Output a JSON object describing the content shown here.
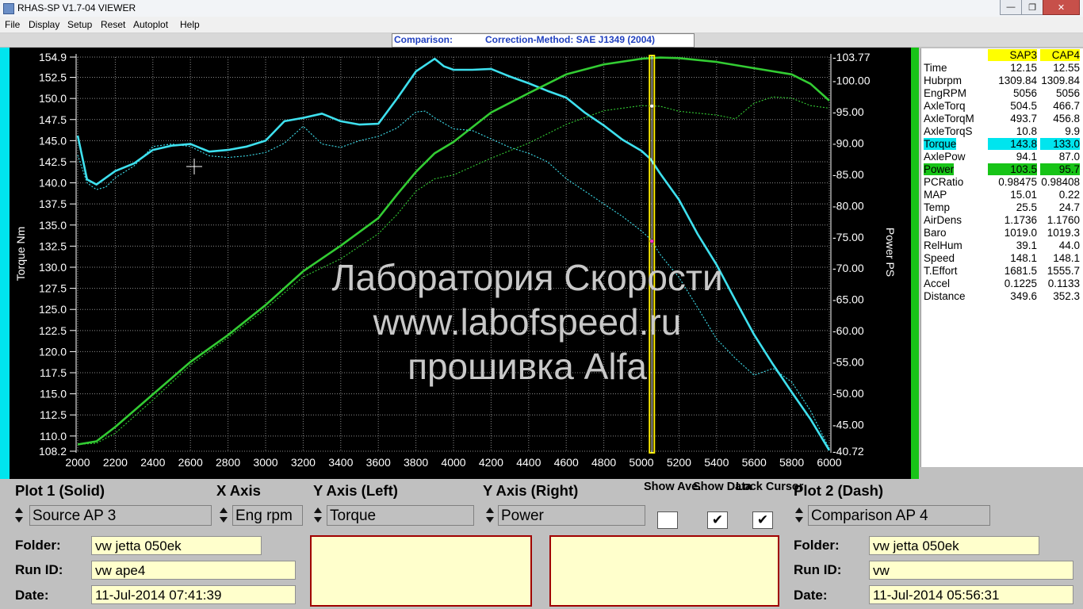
{
  "window": {
    "title": "RHAS-SP V1.7-04  VIEWER",
    "controls": {
      "minimize": "—",
      "maximize": "❐",
      "close": "✕"
    }
  },
  "menu": [
    "File",
    "Display",
    "Setup",
    "Reset",
    "Autoplot",
    "Help"
  ],
  "info": {
    "mode": "Comparison:",
    "correction": "Correction-Method: SAE J1349 (2004)"
  },
  "colors": {
    "torque": "#3ee0ee",
    "power": "#33cc33",
    "cursor": "#ffee00",
    "grid": "#8a8a8a"
  },
  "watermark": [
    "Лаборатория Скорости",
    "www.labofspeed.ru",
    "прошивка Alfa"
  ],
  "chart_data": {
    "type": "line",
    "xlabel": "",
    "ylabel_left": "Torque Nm",
    "ylabel_right": "Power PS",
    "xlim": [
      2000,
      6000
    ],
    "ylim_left": [
      108.2,
      154.9
    ],
    "ylim_right": [
      40.72,
      103.77
    ],
    "x_ticks": [
      "2000",
      "2200",
      "2400",
      "2600",
      "2800",
      "3000",
      "3200",
      "3400",
      "3600",
      "3800",
      "4000",
      "4200",
      "4400",
      "4600",
      "4800",
      "5000",
      "5200",
      "5400",
      "5600",
      "5800",
      "6000"
    ],
    "y_ticks_left": [
      "154.9",
      "152.5",
      "150.0",
      "147.5",
      "145.0",
      "142.5",
      "140.0",
      "137.5",
      "135.0",
      "132.5",
      "130.0",
      "127.5",
      "125.0",
      "122.5",
      "120.0",
      "117.5",
      "115.0",
      "112.5",
      "110.0",
      "108.2"
    ],
    "y_ticks_right": [
      "-103.77",
      "-100.00",
      "-95.00",
      "-90.00",
      "-85.00",
      "-80.00",
      "-75.00",
      "-70.00",
      "-65.00",
      "-60.00",
      "-55.00",
      "-50.00",
      "-45.00",
      "-40.72"
    ],
    "grid": true,
    "cursor_x": 5056,
    "series": [
      {
        "name": "Torque",
        "style": "solid",
        "axis": "left",
        "x": [
          2000,
          2050,
          2100,
          2150,
          2200,
          2300,
          2400,
          2500,
          2600,
          2700,
          2800,
          2900,
          3000,
          3100,
          3200,
          3300,
          3400,
          3500,
          3600,
          3700,
          3800,
          3900,
          3950,
          4000,
          4100,
          4200,
          4300,
          4400,
          4500,
          4600,
          4700,
          4800,
          4900,
          5000,
          5050,
          5100,
          5200,
          5300,
          5400,
          5500,
          5600,
          5700,
          5800,
          5900,
          6000
        ],
        "y": [
          145.6,
          140.4,
          139.8,
          140.6,
          141.4,
          142.3,
          143.9,
          144.4,
          144.6,
          143.7,
          143.9,
          144.3,
          145.0,
          147.3,
          147.7,
          148.2,
          147.3,
          146.9,
          147.0,
          150.0,
          153.2,
          154.7,
          153.8,
          153.4,
          153.4,
          153.5,
          152.6,
          151.8,
          150.9,
          150.1,
          148.3,
          146.8,
          145.1,
          143.8,
          142.8,
          141.1,
          138.0,
          133.9,
          130.3,
          126.1,
          122.0,
          118.5,
          115.2,
          112.0,
          108.3
        ]
      },
      {
        "name": "Power",
        "style": "solid",
        "axis": "right",
        "x": [
          2000,
          2100,
          2200,
          2400,
          2600,
          2800,
          3000,
          3200,
          3400,
          3600,
          3700,
          3800,
          3900,
          4000,
          4200,
          4400,
          4600,
          4800,
          5000,
          5100,
          5200,
          5400,
          5600,
          5800,
          5900,
          6000
        ],
        "y": [
          41.8,
          42.3,
          44.6,
          49.8,
          55.0,
          59.3,
          64.1,
          69.5,
          73.6,
          78.0,
          81.8,
          85.4,
          88.4,
          90.2,
          94.9,
          98.0,
          101.0,
          102.6,
          103.5,
          103.7,
          103.6,
          103.0,
          102.0,
          101.0,
          99.5,
          96.8
        ]
      },
      {
        "name": "Torque",
        "style": "dash",
        "axis": "left",
        "x": [
          2000,
          2050,
          2100,
          2150,
          2200,
          2300,
          2400,
          2500,
          2600,
          2700,
          2800,
          2900,
          3000,
          3100,
          3200,
          3300,
          3400,
          3500,
          3600,
          3700,
          3800,
          3850,
          3900,
          4000,
          4100,
          4200,
          4300,
          4400,
          4500,
          4600,
          4700,
          4800,
          4900,
          5000,
          5050,
          5100,
          5200,
          5300,
          5400,
          5500,
          5600,
          5700,
          5800,
          5900,
          6000
        ],
        "y": [
          143.3,
          140.0,
          139.2,
          139.5,
          140.6,
          142.0,
          144.3,
          144.6,
          144.3,
          143.2,
          143.0,
          143.2,
          143.6,
          144.7,
          146.7,
          144.6,
          144.2,
          145.0,
          145.5,
          146.5,
          148.4,
          148.5,
          147.7,
          146.4,
          146.2,
          145.2,
          144.2,
          143.5,
          142.5,
          140.5,
          139.0,
          137.5,
          136.0,
          134.3,
          133.3,
          131.5,
          128.8,
          125.2,
          121.5,
          119.2,
          117.2,
          118.0,
          116.4,
          113.0,
          108.5
        ]
      },
      {
        "name": "Power",
        "style": "dash",
        "axis": "right",
        "x": [
          2000,
          2100,
          2200,
          2400,
          2600,
          2800,
          3000,
          3200,
          3400,
          3600,
          3700,
          3800,
          3900,
          4000,
          4200,
          4400,
          4600,
          4800,
          5000,
          5100,
          5200,
          5400,
          5500,
          5600,
          5700,
          5800,
          5900,
          6000
        ],
        "y": [
          41.8,
          42.0,
          43.6,
          48.9,
          54.5,
          58.9,
          63.5,
          68.6,
          71.5,
          75.5,
          78.6,
          82.3,
          84.3,
          84.9,
          87.6,
          90.0,
          93.0,
          95.2,
          96.0,
          95.9,
          95.1,
          94.5,
          93.9,
          96.4,
          97.4,
          97.2,
          96.0,
          95.6
        ]
      }
    ]
  },
  "data_table": {
    "headers": [
      "SAP3",
      "CAP4"
    ],
    "rows": [
      {
        "label": "Time",
        "v1": "12.15",
        "v2": "12.55"
      },
      {
        "label": "Hubrpm",
        "v1": "1309.84",
        "v2": "1309.84"
      },
      {
        "label": "EngRPM",
        "v1": "5056",
        "v2": "5056"
      },
      {
        "label": "AxleTorq",
        "v1": "504.5",
        "v2": "466.7"
      },
      {
        "label": "AxleTorqM",
        "v1": "493.7",
        "v2": "456.8"
      },
      {
        "label": "AxleTorqS",
        "v1": "10.8",
        "v2": "9.9"
      },
      {
        "label": "Torque",
        "v1": "143.8",
        "v2": "133.0",
        "highlight": "cyan"
      },
      {
        "label": "AxlePow",
        "v1": "94.1",
        "v2": "87.0"
      },
      {
        "label": "Power",
        "v1": "103.5",
        "v2": "95.7",
        "highlight": "green"
      },
      {
        "label": "PCRatio",
        "v1": "0.98475",
        "v2": "0.98408"
      },
      {
        "label": "MAP",
        "v1": "15.01",
        "v2": "0.22"
      },
      {
        "label": "Temp",
        "v1": "25.5",
        "v2": "24.7"
      },
      {
        "label": "AirDens",
        "v1": "1.1736",
        "v2": "1.1760"
      },
      {
        "label": "Baro",
        "v1": "1019.0",
        "v2": "1019.3"
      },
      {
        "label": "RelHum",
        "v1": "39.1",
        "v2": "44.0"
      },
      {
        "label": "Speed",
        "v1": "148.1",
        "v2": "148.1"
      },
      {
        "label": "T.Effort",
        "v1": "1681.5",
        "v2": "1555.7"
      },
      {
        "label": "Accel",
        "v1": "0.1225",
        "v2": "0.1133"
      },
      {
        "label": "Distance",
        "v1": "349.6",
        "v2": "352.3"
      }
    ]
  },
  "controls": {
    "plot1_label": "Plot 1 (Solid)",
    "xaxis_label": "X Axis",
    "yleft_label": "Y Axis (Left)",
    "yright_label": "Y Axis (Right)",
    "show_ave_label": "Show Ave.",
    "show_data_label": "Show Data",
    "lock_cursor_label": "Lock Cursor",
    "plot2_label": "Plot 2 (Dash)",
    "plot1_value": "Source AP 3",
    "xaxis_value": "Eng rpm",
    "yleft_value": "Torque",
    "yright_value": "Power",
    "plot2_value": "Comparison AP 4",
    "show_ave": false,
    "show_data": true,
    "lock_cursor": true,
    "check_mark": "✔"
  },
  "run1": {
    "folder_label": "Folder:",
    "folder": "vw jetta 050ek",
    "runid_label": "Run ID:",
    "runid": "vw ape4",
    "date_label": "Date:",
    "date": "11-Jul-2014  07:41:39"
  },
  "run2": {
    "folder_label": "Folder:",
    "folder": "vw jetta 050ek",
    "runid_label": "Run ID:",
    "runid": "vw",
    "date_label": "Date:",
    "date": "11-Jul-2014  05:56:31"
  }
}
